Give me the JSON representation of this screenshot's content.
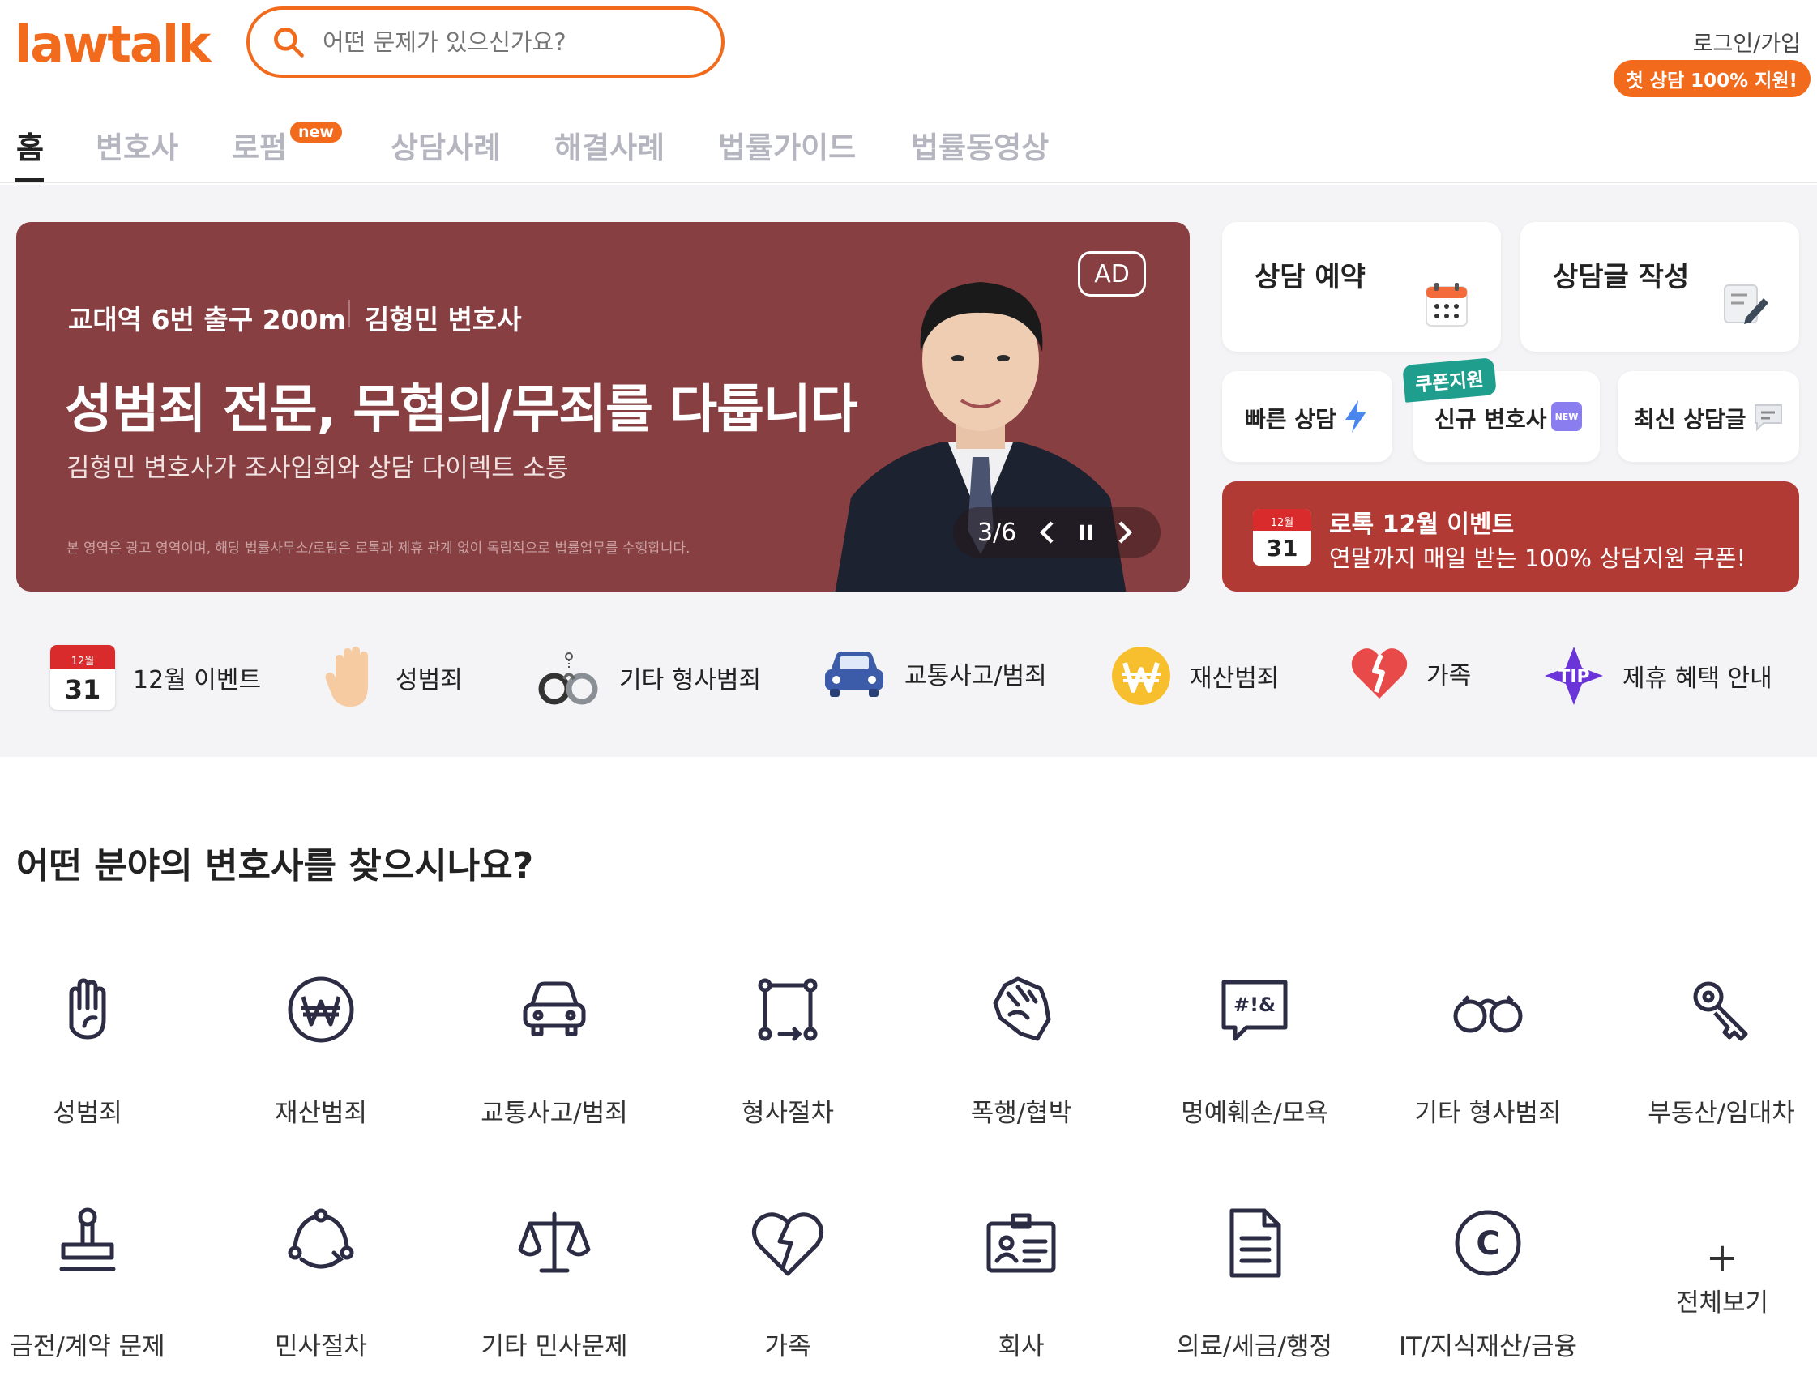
{
  "header": {
    "logo": "lawtalk",
    "search_placeholder": "어떤 문제가 있으신가요?",
    "login": "로그인/가입",
    "promo": "첫 상담 100% 지원!"
  },
  "nav": {
    "tabs": [
      "홈",
      "변호사",
      "로펌",
      "상담사례",
      "해결사례",
      "법률가이드",
      "법률동영상"
    ],
    "new_badge": "new"
  },
  "banner": {
    "location": "교대역 6번 출구 200m",
    "lawyer": "김형민 변호사",
    "title": "성범죄 전문, 무혐의/무죄를 다툽니다",
    "description": "김형민 변호사가 조사입회와 상담 다이렉트 소통",
    "disclaimer": "본 영역은 광고 영역이며, 해당 법률사무소/로펌은 로톡과 제휴 관계 없이 독립적으로 법률업무를 수행합니다.",
    "ad_label": "AD",
    "pager": "3/6"
  },
  "cards": {
    "reserve": "상담 예약",
    "write": "상담글 작성",
    "fast": "빠른 상담",
    "new_lawyer": "신규 변호사",
    "new_mark": "NEW",
    "latest": "최신 상담글",
    "coupon_tag": "쿠폰지원"
  },
  "event": {
    "title": "로톡 12월 이벤트",
    "subtitle": "연말까지 매일 받는 100% 상담지원 쿠폰!",
    "cal_month": "12월",
    "cal_day": "31"
  },
  "quick_categories": [
    "12월 이벤트",
    "성범죄",
    "기타 형사범죄",
    "교통사고/범죄",
    "재산범죄",
    "가족",
    "제휴 혜택 안내"
  ],
  "quick_tip": "TIP",
  "section_title": "어떤 분야의 변호사를 찾으시나요?",
  "fields_row1": [
    "성범죄",
    "재산범죄",
    "교통사고/범죄",
    "형사절차",
    "폭행/협박",
    "명예훼손/모욕",
    "기타 형사범죄",
    "부동산/임대차"
  ],
  "fields_row2": [
    "금전/계약 문제",
    "민사절차",
    "기타 민사문제",
    "가족",
    "회사",
    "의료/세금/행정",
    "IT/지식재산/금융"
  ],
  "more": {
    "plus": "+",
    "label": "전체보기"
  },
  "defamation_glyph": "#!&",
  "copyright_glyph": "C",
  "colors": {
    "brand": "#f26b1d",
    "banner_bg": "#873f42",
    "event_bg": "#b13a35",
    "icon": "#2c2c44"
  }
}
